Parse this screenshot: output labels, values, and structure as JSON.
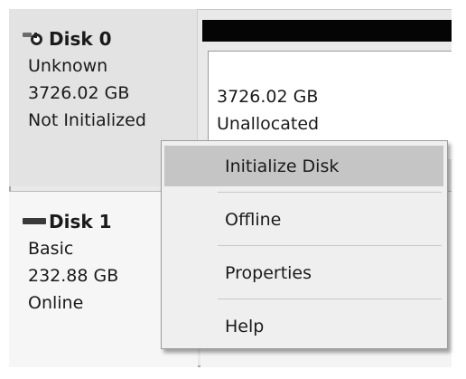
{
  "disks": [
    {
      "name": "Disk 0",
      "icon": "uninitialized-disk-icon",
      "type": "Unknown",
      "size": "3726.02 GB",
      "status": "Not Initialized",
      "volume": {
        "size": "3726.02 GB",
        "state": "Unallocated"
      }
    },
    {
      "name": "Disk 1",
      "icon": "basic-disk-icon",
      "type": "Basic",
      "size": "232.88 GB",
      "status": "Online"
    }
  ],
  "context_menu": {
    "items": [
      {
        "label": "Initialize Disk",
        "selected": true
      },
      {
        "label": "Offline",
        "selected": false
      },
      {
        "label": "Properties",
        "selected": false
      },
      {
        "label": "Help",
        "selected": false
      }
    ]
  },
  "colors": {
    "selection": "#c5c5c5",
    "menu_background": "#efefef",
    "volume_header": "#050505"
  }
}
